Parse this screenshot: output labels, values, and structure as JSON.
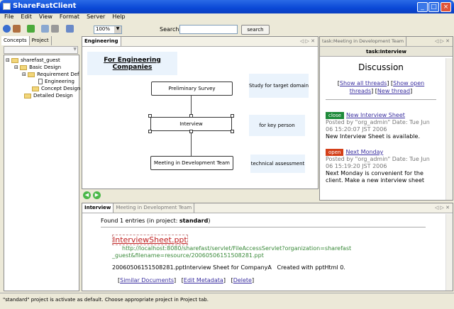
{
  "window": {
    "title": "ShareFastClient"
  },
  "menu": [
    "File",
    "Edit",
    "View",
    "Format",
    "Server",
    "Help"
  ],
  "toolbar": {
    "zoom": "100%",
    "search_label": "Search",
    "search_value": "",
    "search_button": "search"
  },
  "left": {
    "tabs": [
      "Concepts",
      "Project"
    ],
    "tree": [
      "sharefast_guest",
      "Basic Design",
      "Requirement Def",
      "Engineering",
      "Concept Design",
      "Detailed Design"
    ]
  },
  "center": {
    "tab": "Engineering",
    "title": "For Engineering Companies",
    "nodes": [
      "Preliminary Survey",
      "Interview",
      "Meeting in Development Team"
    ],
    "notes": [
      "Study for target domain",
      "for key person",
      "technical assessment"
    ]
  },
  "right": {
    "tab1": "task:Meeting in Development Team",
    "tab2": "task:Interview",
    "heading": "Discussion",
    "links": [
      "Show all threads",
      "Show open threads",
      "New thread"
    ],
    "threads": [
      {
        "status": "close",
        "status_color": "#1e8a3a",
        "title": "New Interview Sheet",
        "meta": "Posted by \"org_admin\" Date: Tue Jun 06 15:20:07 JST 2006",
        "body": "New Interview Sheet is available."
      },
      {
        "status": "open",
        "status_color": "#d4401a",
        "title": "Next Monday",
        "meta": "Posted by \"org_admin\" Date: Tue Jun 06 15:19:20 JST 2006",
        "body": "Next Monday is convenient for the client. Make a new interview sheet"
      }
    ]
  },
  "bottom": {
    "tabs": [
      "Interview",
      "Meeting in Development Team"
    ],
    "found_prefix": "Found 1 entries (in project: ",
    "found_project": "standard",
    "found_suffix": ")",
    "file": "InterviewSheet.ppt",
    "url": "http://localhost:8080/sharefast/servlet/FileAccessServlet?organization=sharefast_guest&filename=resource/20060506151508281.ppt",
    "desc": "20060506151508281.pptInterview Sheet for CompanyA   Created with pptHtml 0.",
    "actions": [
      "Similar Documents",
      "Edit Metadata",
      "Delete"
    ]
  },
  "status": "\"standard\" project is activate as default. Choose appropriate project in Project tab."
}
